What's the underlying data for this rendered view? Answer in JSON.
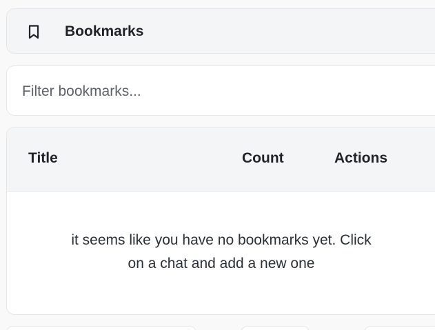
{
  "header": {
    "title": "Bookmarks",
    "icon": "bookmark-icon"
  },
  "filter": {
    "placeholder": "Filter bookmarks...",
    "value": ""
  },
  "table": {
    "columns": [
      "Title",
      "Count",
      "Actions"
    ],
    "rows": [],
    "empty_message_line1": "it seems like you have no bookmarks yet. Click",
    "empty_message_line2": "on a chat and add a new one"
  }
}
